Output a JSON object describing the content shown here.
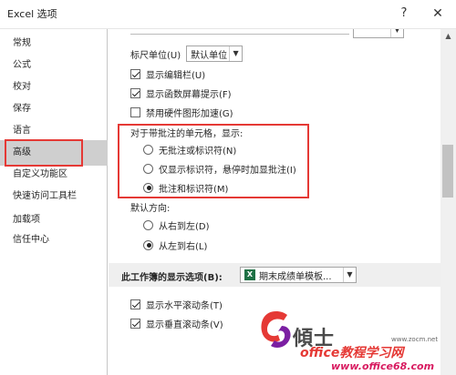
{
  "window": {
    "title": "Excel 选项",
    "help_glyph": "?",
    "close_glyph": "✕"
  },
  "nav": {
    "items": [
      {
        "label": "常规"
      },
      {
        "label": "公式"
      },
      {
        "label": "校对"
      },
      {
        "label": "保存"
      },
      {
        "label": "语言"
      },
      {
        "label": "高级",
        "active": true
      },
      {
        "label": "自定义功能区"
      },
      {
        "label": "快速访问工具栏"
      },
      {
        "label": "加载项"
      },
      {
        "label": "信任中心"
      }
    ]
  },
  "main": {
    "ruler_unit": {
      "label": "标尺单位(U)",
      "value": "默认单位"
    },
    "checkboxes_top": [
      {
        "label": "显示编辑栏(U)",
        "checked": true
      },
      {
        "label": "显示函数屏幕提示(F)",
        "checked": true
      },
      {
        "label": "禁用硬件图形加速(G)",
        "checked": false
      }
    ],
    "comments_group": {
      "label": "对于带批注的单元格，显示:",
      "options": [
        {
          "label": "无批注或标识符(N)",
          "checked": false
        },
        {
          "label": "仅显示标识符，悬停时加显批注(I)",
          "checked": false
        },
        {
          "label": "批注和标识符(M)",
          "checked": true
        }
      ]
    },
    "direction_group": {
      "label": "默认方向:",
      "options": [
        {
          "label": "从右到左(D)",
          "checked": false
        },
        {
          "label": "从左到右(L)",
          "checked": true
        }
      ]
    },
    "workbook_section": {
      "title": "此工作簿的显示选项(B):",
      "workbook_name": "期末成绩单模板..."
    },
    "checkboxes_bottom": [
      {
        "label": "显示水平滚动条(T)",
        "checked": true
      },
      {
        "label": "显示垂直滚动条(V)",
        "checked": true
      }
    ]
  },
  "watermark": {
    "title": "傾士",
    "site": "office教程学习网",
    "url": "www.office68.com",
    "small": "www.zocm.net"
  },
  "colors": {
    "highlight_red": "#e53935",
    "nav_active": "#cfcfcf",
    "excel_green": "#1e7145"
  }
}
